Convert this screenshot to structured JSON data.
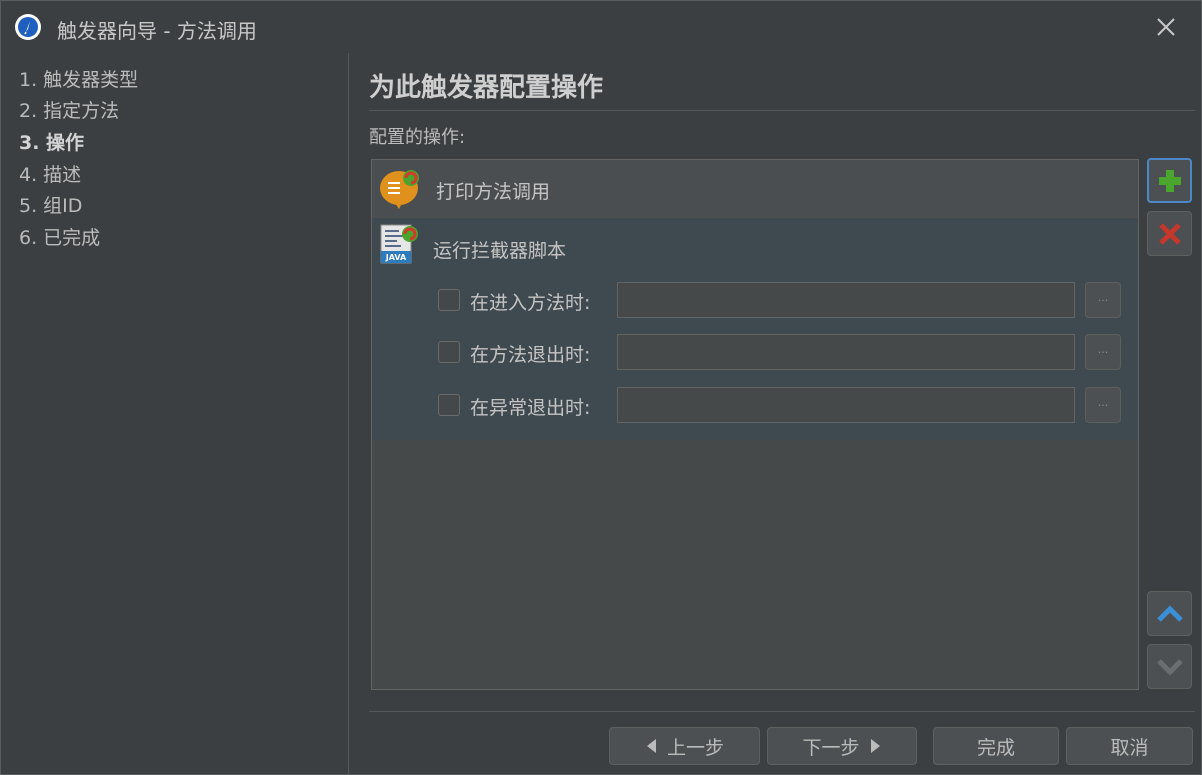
{
  "window": {
    "title": "触发器向导 - 方法调用",
    "app_icon": "compass-icon",
    "close_icon": "close-icon"
  },
  "steps": [
    {
      "label": "1. 触发器类型",
      "active": false
    },
    {
      "label": "2. 指定方法",
      "active": false
    },
    {
      "label": "3. 操作",
      "active": true
    },
    {
      "label": "4. 描述",
      "active": false
    },
    {
      "label": "5. 组ID",
      "active": false
    },
    {
      "label": "6. 已完成",
      "active": false
    }
  ],
  "main": {
    "title": "为此触发器配置操作",
    "section_label": "配置的操作:",
    "actions": [
      {
        "label": "打印方法调用",
        "icon": "print-message-icon"
      },
      {
        "label": "运行拦截器脚本",
        "icon": "java-script-icon"
      }
    ],
    "script_options": [
      {
        "label": "在进入方法时:",
        "checked": false,
        "value": ""
      },
      {
        "label": "在方法退出时:",
        "checked": false,
        "value": ""
      },
      {
        "label": "在异常退出时:",
        "checked": false,
        "value": ""
      }
    ],
    "ellipsis": "···"
  },
  "side_buttons": {
    "add_icon": "plus-icon",
    "remove_icon": "remove-icon",
    "up_icon": "move-up-icon",
    "down_icon": "move-down-icon"
  },
  "footer": {
    "back": "上一步",
    "next": "下一步",
    "finish": "完成",
    "cancel": "取消"
  },
  "colors": {
    "background": "#3c3f41",
    "selection": "#3f4950",
    "accent": "#4a88c7",
    "add_green": "#4aa52e",
    "remove_red": "#c4372a"
  }
}
